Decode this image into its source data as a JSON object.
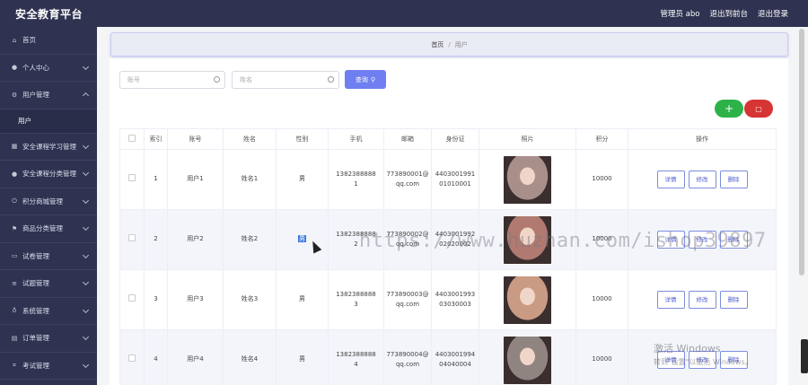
{
  "app": {
    "title": "安全教育平台"
  },
  "header": {
    "admin": "管理员 abo",
    "back": "退出到前台",
    "logout": "退出登录"
  },
  "sidebar": {
    "items": [
      {
        "label": "首页",
        "icon": "home-icon",
        "expand": false
      },
      {
        "label": "个人中心",
        "icon": "user-icon",
        "expand": true
      },
      {
        "label": "用户管理",
        "icon": "settings-icon",
        "expand": true,
        "open": true,
        "sub": [
          "用户"
        ]
      },
      {
        "label": "安全课程学习管理",
        "icon": "table-icon",
        "expand": true
      },
      {
        "label": "安全课程分类管理",
        "icon": "user-icon",
        "expand": true
      },
      {
        "label": "积分商城管理",
        "icon": "power-icon",
        "expand": true
      },
      {
        "label": "商品分类管理",
        "icon": "flag-icon",
        "expand": true
      },
      {
        "label": "试卷管理",
        "icon": "folder-icon",
        "expand": true
      },
      {
        "label": "试题管理",
        "icon": "list-icon",
        "expand": true
      },
      {
        "label": "系统管理",
        "icon": "bulb-icon",
        "expand": true
      },
      {
        "label": "订单管理",
        "icon": "doc-icon",
        "expand": true
      },
      {
        "label": "考试管理",
        "icon": "scan-icon",
        "expand": true
      }
    ]
  },
  "breadcrumb": {
    "home": "首页",
    "sep": "/",
    "current": "用户"
  },
  "search": {
    "account_placeholder": "账号",
    "name_placeholder": "姓名",
    "button": "查询"
  },
  "table": {
    "headers": [
      "",
      "索引",
      "账号",
      "姓名",
      "性别",
      "手机",
      "邮箱",
      "身份证",
      "照片",
      "积分",
      "操作"
    ],
    "ops": {
      "detail": "详情",
      "edit": "修改",
      "delete": "删除"
    },
    "rows": [
      {
        "index": "1",
        "account": "用户1",
        "name": "姓名1",
        "gender": "男",
        "phone1": "1382388888",
        "phone2": "1",
        "email1": "773890001@",
        "email2": "qq.com",
        "id1": "4403001991",
        "id2": "01010001",
        "points": "10000",
        "photo": "#a98f8a"
      },
      {
        "index": "2",
        "account": "用户2",
        "name": "姓名2",
        "gender": "男",
        "phone1": "1382388888",
        "phone2": "2",
        "email1": "773890002@",
        "email2": "qq.com",
        "id1": "4403001992",
        "id2": "02020002",
        "points": "10000",
        "photo": "#b07a70"
      },
      {
        "index": "3",
        "account": "用户3",
        "name": "姓名3",
        "gender": "男",
        "phone1": "1382388888",
        "phone2": "3",
        "email1": "773890003@",
        "email2": "qq.com",
        "id1": "4403001993",
        "id2": "03030003",
        "points": "10000",
        "photo": "#c99a84"
      },
      {
        "index": "4",
        "account": "用户4",
        "name": "姓名4",
        "gender": "男",
        "phone1": "1382388888",
        "phone2": "4",
        "email1": "773890004@",
        "email2": "qq.com",
        "id1": "4403001994",
        "id2": "04040004",
        "points": "10000",
        "photo": "#8f8480"
      }
    ]
  },
  "overlay": {
    "watermark": "https://www.huzhan.com/ishop39897",
    "activate_line1": "激活 Windows",
    "activate_line2": "转到\"设置\"以激活 Windows。"
  },
  "colors": {
    "sidebar": "#2f3250",
    "primary": "#6f7ef0",
    "add": "#2db24a",
    "danger": "#d73434"
  }
}
